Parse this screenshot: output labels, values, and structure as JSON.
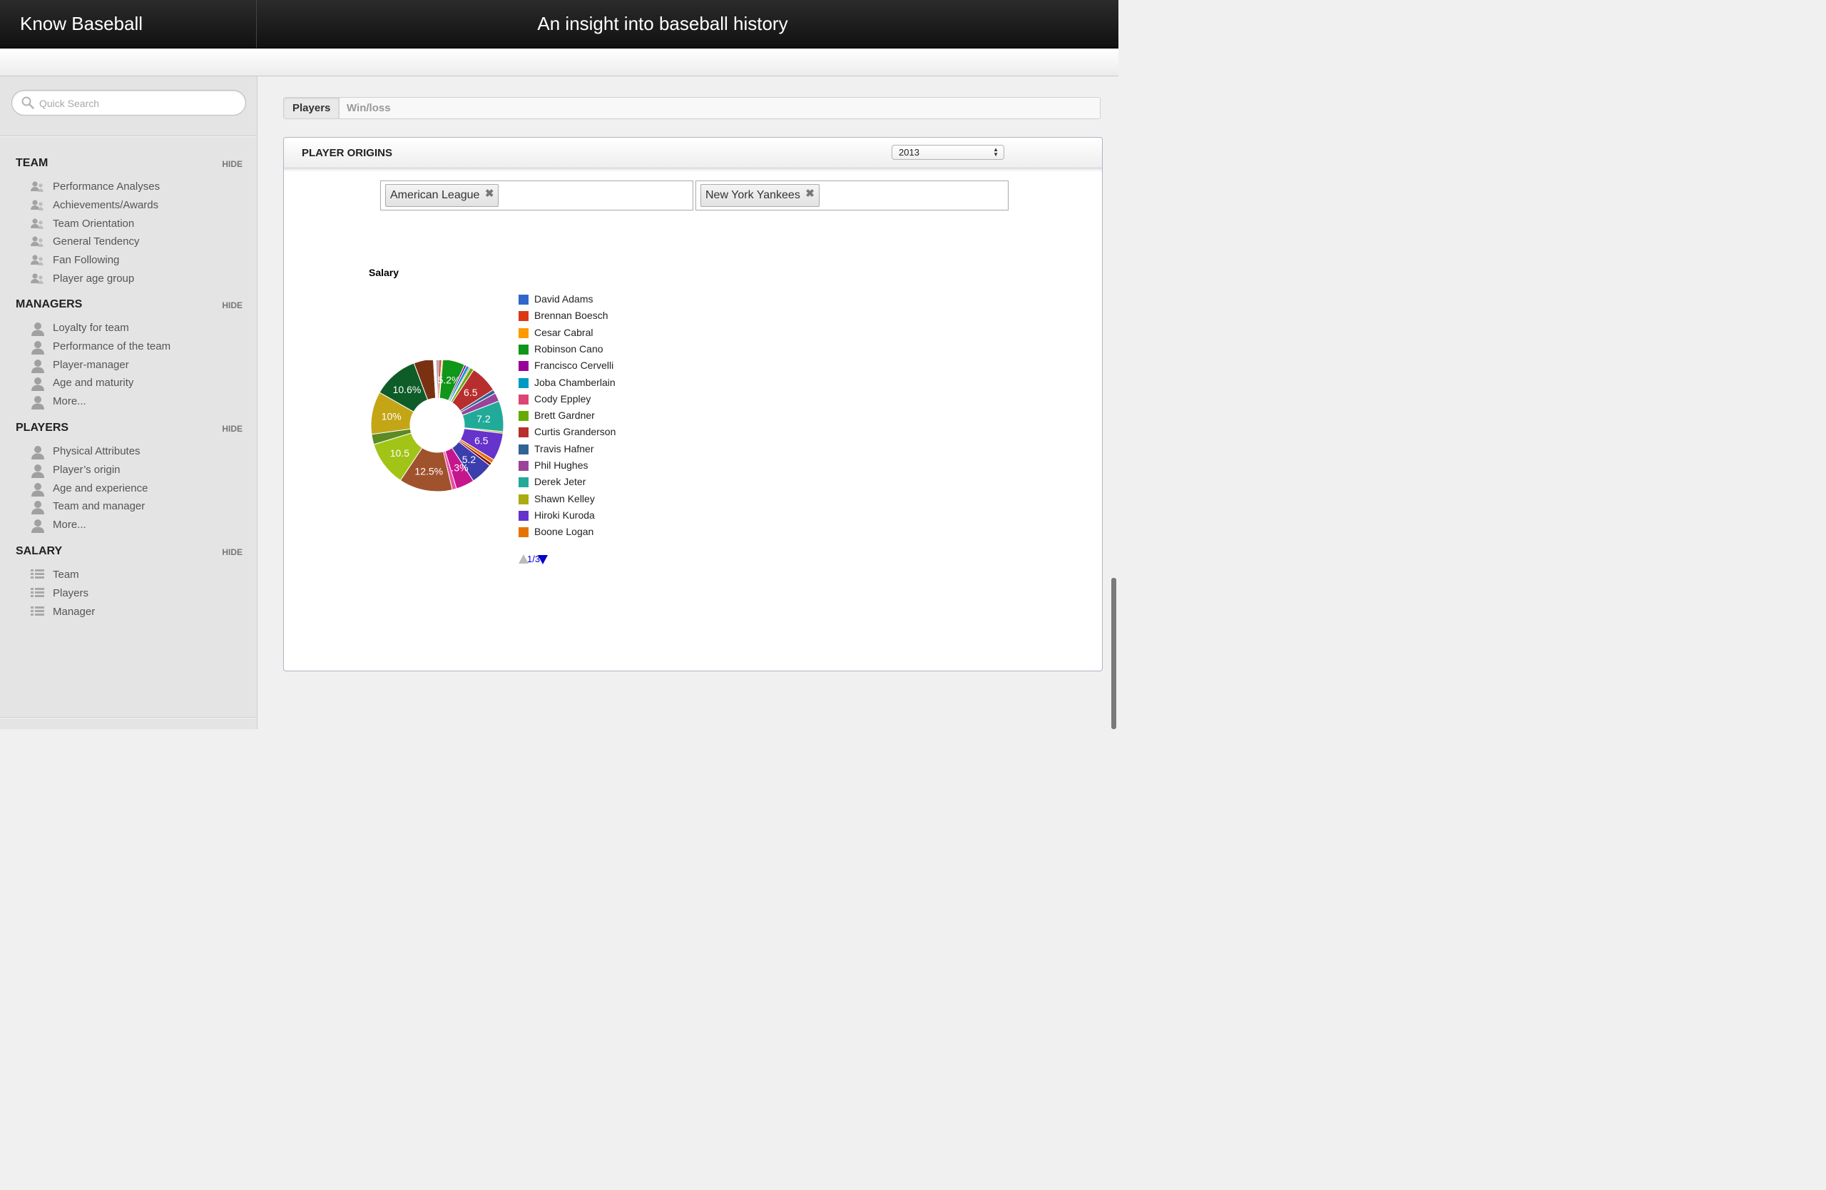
{
  "header": {
    "brand": "Know Baseball",
    "tagline": "An insight into baseball history"
  },
  "search": {
    "placeholder": "Quick Search"
  },
  "sidebar": {
    "hide_label": "HIDE",
    "sections": [
      {
        "title": "TEAM",
        "icon": "group-icon",
        "items": [
          "Performance Analyses",
          "Achievements/Awards",
          "Team Orientation",
          "General Tendency",
          "Fan Following",
          "Player age group"
        ]
      },
      {
        "title": "MANAGERS",
        "icon": "person-icon",
        "items": [
          "Loyalty for team",
          "Performance of the team",
          "Player-manager",
          "Age and maturity",
          "More..."
        ]
      },
      {
        "title": "PLAYERS",
        "icon": "person-icon",
        "items": [
          "Physical Attributes",
          "Player’s origin",
          "Age and experience",
          "Team and manager",
          "More..."
        ]
      },
      {
        "title": "SALARY",
        "icon": "list-icon",
        "items": [
          "Team",
          "Players",
          "Manager"
        ]
      }
    ]
  },
  "tabs": {
    "players": "Players",
    "winloss": "Win/loss"
  },
  "panel": {
    "title": "PLAYER ORIGINS",
    "year": "2013",
    "filters": [
      "American League",
      "New York Yankees"
    ]
  },
  "chart_data": {
    "type": "pie",
    "donut": true,
    "title": "Salary",
    "legend": [
      "David Adams",
      "Brennan Boesch",
      "Cesar Cabral",
      "Robinson Cano",
      "Francisco Cervelli",
      "Joba Chamberlain",
      "Cody Eppley",
      "Brett Gardner",
      "Curtis Granderson",
      "Travis Hafner",
      "Phil Hughes",
      "Derek Jeter",
      "Shawn Kelley",
      "Hiroki Kuroda",
      "Boone Logan"
    ],
    "legend_colors": [
      "#3366cc",
      "#dc3912",
      "#ff9900",
      "#109618",
      "#990099",
      "#0099c6",
      "#dd4477",
      "#66aa00",
      "#b82e2e",
      "#316395",
      "#994499",
      "#22aa99",
      "#aaaa11",
      "#6633cc",
      "#e67300"
    ],
    "legend_position": "right",
    "legend_page": "1/3",
    "slices": [
      {
        "value": 0.4,
        "color": "#3366cc",
        "label": ""
      },
      {
        "value": 0.6,
        "color": "#dc3912",
        "label": ""
      },
      {
        "value": 0.3,
        "color": "#ff9900",
        "label": ""
      },
      {
        "value": 5.2,
        "color": "#109618",
        "label": "5.2%"
      },
      {
        "value": 0.5,
        "color": "#990099",
        "label": ""
      },
      {
        "value": 0.7,
        "color": "#0099c6",
        "label": ""
      },
      {
        "value": 0.3,
        "color": "#dd4477",
        "label": ""
      },
      {
        "value": 0.9,
        "color": "#66aa00",
        "label": ""
      },
      {
        "value": 6.5,
        "color": "#b82e2e",
        "label": "6.5"
      },
      {
        "value": 0.9,
        "color": "#316395",
        "label": ""
      },
      {
        "value": 2.0,
        "color": "#994499",
        "label": ""
      },
      {
        "value": 7.2,
        "color": "#22aa99",
        "label": "7.2"
      },
      {
        "value": 0.4,
        "color": "#aaaa11",
        "label": ""
      },
      {
        "value": 6.5,
        "color": "#6633cc",
        "label": "6.5"
      },
      {
        "value": 0.9,
        "color": "#e67300",
        "label": ""
      },
      {
        "value": 0.7,
        "color": "#8b0707",
        "label": ""
      },
      {
        "value": 5.2,
        "color": "#3b3eac",
        "label": "5.2"
      },
      {
        "value": 4.3,
        "color": "#c6168d",
        "label": "4.3%"
      },
      {
        "value": 1.0,
        "color": "#e94ca6",
        "label": ""
      },
      {
        "value": 12.5,
        "color": "#a0522d",
        "label": "12.5%"
      },
      {
        "value": 10.5,
        "color": "#a1c416",
        "label": "10.5"
      },
      {
        "value": 2.4,
        "color": "#5c8a24",
        "label": ""
      },
      {
        "value": 10.0,
        "color": "#c4a516",
        "label": "10%"
      },
      {
        "value": 10.6,
        "color": "#0e5c27",
        "label": "10.6%"
      },
      {
        "value": 4.6,
        "color": "#7a3112",
        "label": ""
      },
      {
        "value": 0.6,
        "color": "#ffffff",
        "label": ""
      },
      {
        "value": 0.3,
        "color": "#b85e3a",
        "label": ""
      }
    ]
  }
}
